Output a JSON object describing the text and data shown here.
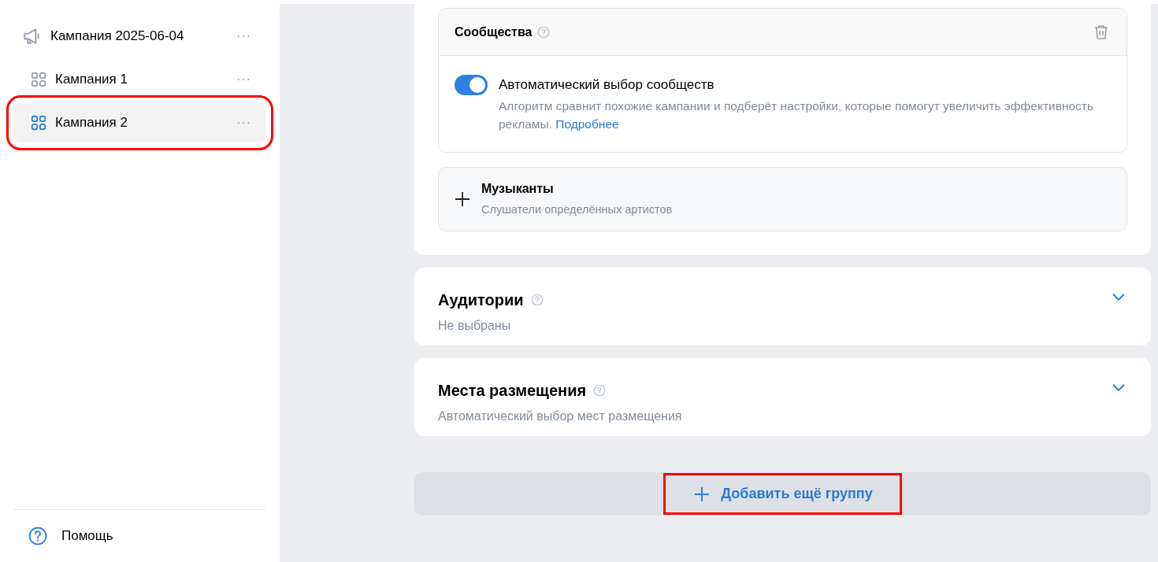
{
  "sidebar": {
    "campaign": {
      "title": "Кампания 2025-06-04",
      "menu": "···",
      "selected": false,
      "highlighted": false,
      "children": [
        {
          "title": "Кампания 1",
          "menu": "···",
          "selected": false,
          "highlighted": false
        },
        {
          "title": "Кампания 2",
          "menu": "···",
          "selected": true,
          "highlighted": true
        }
      ]
    },
    "help": "Помощь"
  },
  "communities": {
    "title": "Сообщества",
    "toggle": {
      "label": "Автоматический выбор сообществ",
      "on": true,
      "description": "Алгоритм сравнит похожие кампании и подберёт настройки, которые помогут увеличить эффективность рекламы.",
      "link": "Подробнее"
    }
  },
  "add_option": {
    "title": "Музыканты",
    "subtitle": "Слушатели определённых артистов"
  },
  "sections": [
    {
      "title": "Аудитории",
      "subtitle": "Не выбраны",
      "expanded": false
    },
    {
      "title": "Места размещения",
      "subtitle": "Автоматический выбор мест размещения",
      "expanded": false
    }
  ],
  "add_group_button": {
    "label": "Добавить ещё группу",
    "highlighted": true
  }
}
